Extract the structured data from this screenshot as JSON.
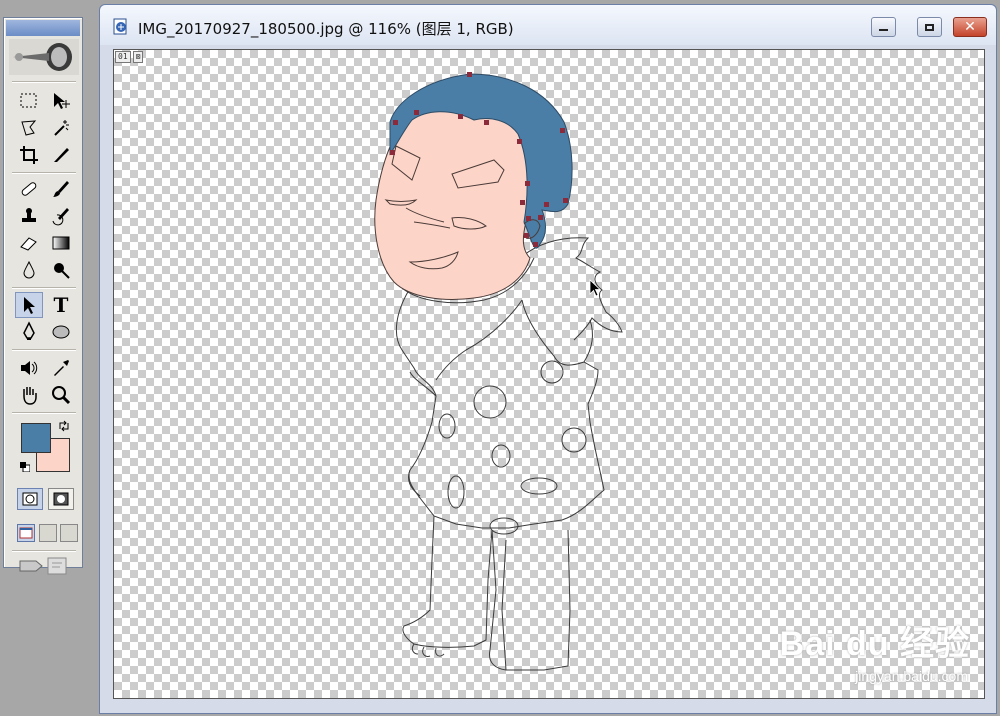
{
  "document": {
    "title": "IMG_20170927_180500.jpg @ 116% (图层 1, RGB)",
    "zoom": "116%",
    "layer_badges": [
      "01",
      "⊠"
    ],
    "window_controls": [
      "minimize",
      "maximize",
      "close"
    ]
  },
  "toolbox": {
    "tools": [
      {
        "name": "marquee-tool",
        "icon": "marquee-icon"
      },
      {
        "name": "move-tool",
        "icon": "move-icon"
      },
      {
        "name": "lasso-tool",
        "icon": "lasso-icon"
      },
      {
        "name": "magic-wand-tool",
        "icon": "magic-wand-icon"
      },
      {
        "name": "crop-tool",
        "icon": "crop-icon"
      },
      {
        "name": "slice-tool",
        "icon": "slice-icon"
      },
      {
        "name": "healing-brush-tool",
        "icon": "bandage-icon"
      },
      {
        "name": "brush-tool",
        "icon": "brush-icon"
      },
      {
        "name": "stamp-tool",
        "icon": "stamp-icon"
      },
      {
        "name": "history-brush-tool",
        "icon": "history-brush-icon"
      },
      {
        "name": "eraser-tool",
        "icon": "eraser-icon"
      },
      {
        "name": "gradient-tool",
        "icon": "gradient-icon"
      },
      {
        "name": "blur-tool",
        "icon": "drop-icon"
      },
      {
        "name": "dodge-tool",
        "icon": "dodge-icon"
      },
      {
        "name": "path-selection-tool",
        "icon": "arrow-icon",
        "active": true
      },
      {
        "name": "type-tool",
        "icon": "type-icon",
        "label": "T"
      },
      {
        "name": "pen-tool",
        "icon": "pen-icon"
      },
      {
        "name": "ellipse-tool",
        "icon": "ellipse-icon"
      },
      {
        "name": "notes-tool",
        "icon": "speaker-icon"
      },
      {
        "name": "eyedropper-tool",
        "icon": "eyedropper-icon"
      },
      {
        "name": "hand-tool",
        "icon": "hand-icon"
      },
      {
        "name": "zoom-tool",
        "icon": "magnifier-icon"
      }
    ],
    "foreground_color": "#4a7ea6",
    "background_color": "#fdd5c8"
  },
  "colors": {
    "hair": "#4a7ea6",
    "skin": "#fdd5c8",
    "anchor": "#8a2a3a",
    "outline": "#3a3a3a"
  },
  "watermark": {
    "main": "Bai du 经验",
    "url": "jingyan.baidu.com"
  }
}
